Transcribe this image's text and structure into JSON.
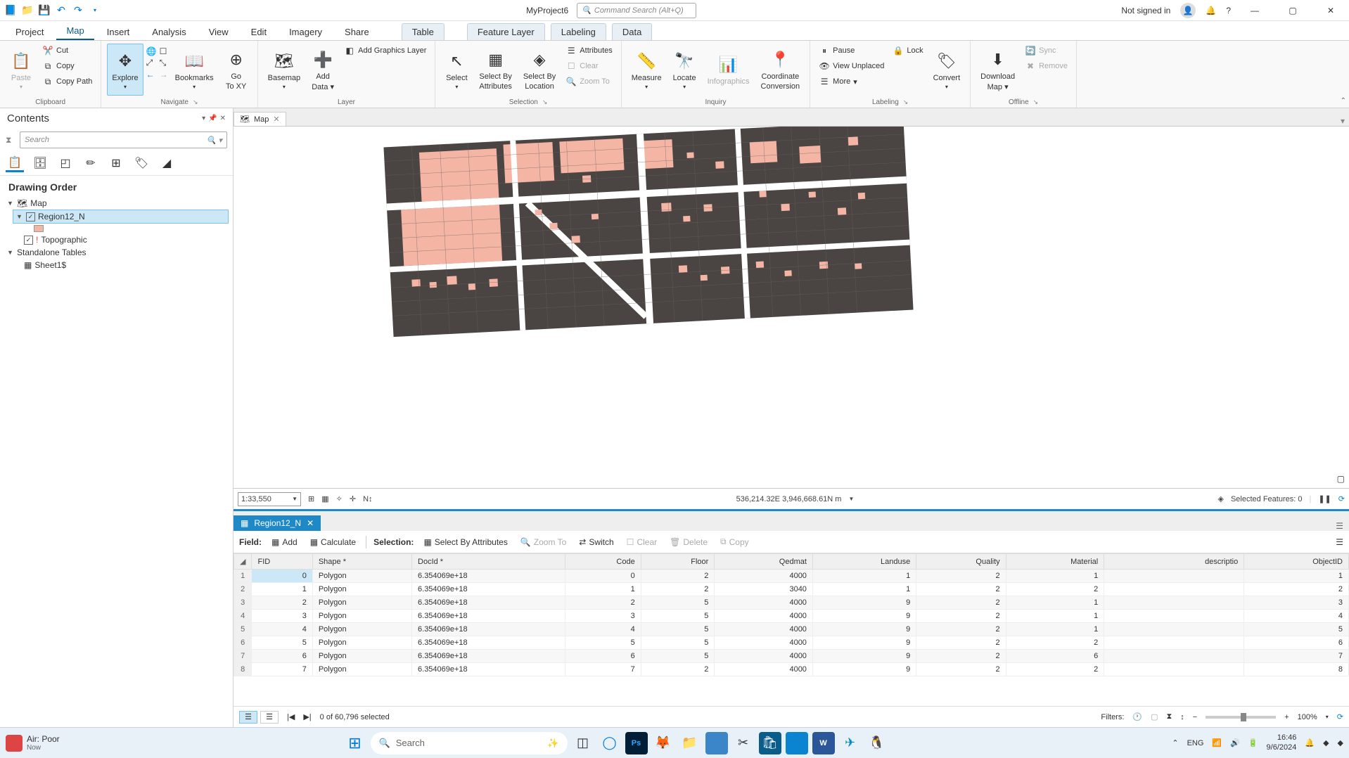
{
  "titlebar": {
    "project_name": "MyProject6",
    "command_search_placeholder": "Command Search (Alt+Q)",
    "signin": "Not signed in"
  },
  "tabs": {
    "project": "Project",
    "map": "Map",
    "insert": "Insert",
    "analysis": "Analysis",
    "view": "View",
    "edit": "Edit",
    "imagery": "Imagery",
    "share": "Share",
    "table": "Table",
    "feature_layer": "Feature Layer",
    "labeling": "Labeling",
    "data": "Data"
  },
  "ribbon": {
    "clipboard": {
      "label": "Clipboard",
      "paste": "Paste",
      "cut": "Cut",
      "copy": "Copy",
      "copy_path": "Copy Path"
    },
    "navigate": {
      "label": "Navigate",
      "explore": "Explore",
      "bookmarks": "Bookmarks",
      "goto_xy_l1": "Go",
      "goto_xy_l2": "To XY"
    },
    "layer": {
      "label": "Layer",
      "basemap": "Basemap",
      "add_data_l1": "Add",
      "add_data_l2": "Data",
      "add_graphics": "Add Graphics Layer"
    },
    "selection": {
      "label": "Selection",
      "select": "Select",
      "by_attr_l1": "Select By",
      "by_attr_l2": "Attributes",
      "by_loc_l1": "Select By",
      "by_loc_l2": "Location",
      "attributes": "Attributes",
      "clear": "Clear",
      "zoom_to": "Zoom To"
    },
    "inquiry": {
      "label": "Inquiry",
      "measure": "Measure",
      "locate": "Locate",
      "infographics": "Infographics",
      "coord_l1": "Coordinate",
      "coord_l2": "Conversion"
    },
    "labeling": {
      "label": "Labeling",
      "pause": "Pause",
      "lock": "Lock",
      "view_unplaced": "View Unplaced",
      "more": "More",
      "convert": "Convert"
    },
    "offline": {
      "label": "Offline",
      "download_l1": "Download",
      "download_l2": "Map",
      "sync": "Sync",
      "remove": "Remove"
    }
  },
  "contents": {
    "title": "Contents",
    "search_placeholder": "Search",
    "drawing_order": "Drawing Order",
    "map_node": "Map",
    "layer_region": "Region12_N",
    "layer_topo": "Topographic",
    "standalone": "Standalone Tables",
    "sheet": "Sheet1$"
  },
  "map_view": {
    "tab": "Map",
    "scale": "1:33,550",
    "coords": "536,214.32E 3,946,668.61N m",
    "selected_features": "Selected Features: 0"
  },
  "attr_table": {
    "tab": "Region12_N",
    "field_label": "Field:",
    "add": "Add",
    "calculate": "Calculate",
    "selection_label": "Selection:",
    "sel_by_attr": "Select By Attributes",
    "zoom_to": "Zoom To",
    "switch": "Switch",
    "clear": "Clear",
    "delete": "Delete",
    "copy": "Copy",
    "columns": [
      "FID",
      "Shape *",
      "DocId *",
      "Code",
      "Floor",
      "Qedmat",
      "Landuse",
      "Quality",
      "Material",
      "descriptio",
      "ObjectID"
    ],
    "rows": [
      {
        "n": 1,
        "fid": 0,
        "shape": "Polygon",
        "docid": "6.354069e+18",
        "code": 0,
        "floor": 2,
        "qedmat": 4000,
        "landuse": 1,
        "quality": 2,
        "material": 1,
        "desc": "",
        "oid": 1
      },
      {
        "n": 2,
        "fid": 1,
        "shape": "Polygon",
        "docid": "6.354069e+18",
        "code": 1,
        "floor": 2,
        "qedmat": 3040,
        "landuse": 1,
        "quality": 2,
        "material": 2,
        "desc": "",
        "oid": 2
      },
      {
        "n": 3,
        "fid": 2,
        "shape": "Polygon",
        "docid": "6.354069e+18",
        "code": 2,
        "floor": 5,
        "qedmat": 4000,
        "landuse": 9,
        "quality": 2,
        "material": 1,
        "desc": "",
        "oid": 3
      },
      {
        "n": 4,
        "fid": 3,
        "shape": "Polygon",
        "docid": "6.354069e+18",
        "code": 3,
        "floor": 5,
        "qedmat": 4000,
        "landuse": 9,
        "quality": 2,
        "material": 1,
        "desc": "",
        "oid": 4
      },
      {
        "n": 5,
        "fid": 4,
        "shape": "Polygon",
        "docid": "6.354069e+18",
        "code": 4,
        "floor": 5,
        "qedmat": 4000,
        "landuse": 9,
        "quality": 2,
        "material": 1,
        "desc": "",
        "oid": 5
      },
      {
        "n": 6,
        "fid": 5,
        "shape": "Polygon",
        "docid": "6.354069e+18",
        "code": 5,
        "floor": 5,
        "qedmat": 4000,
        "landuse": 9,
        "quality": 2,
        "material": 2,
        "desc": "",
        "oid": 6
      },
      {
        "n": 7,
        "fid": 6,
        "shape": "Polygon",
        "docid": "6.354069e+18",
        "code": 6,
        "floor": 5,
        "qedmat": 4000,
        "landuse": 9,
        "quality": 2,
        "material": 6,
        "desc": "",
        "oid": 7
      },
      {
        "n": 8,
        "fid": 7,
        "shape": "Polygon",
        "docid": "6.354069e+18",
        "code": 7,
        "floor": 2,
        "qedmat": 4000,
        "landuse": 9,
        "quality": 2,
        "material": 2,
        "desc": "",
        "oid": 8
      }
    ],
    "record_status": "0 of 60,796 selected",
    "filters": "Filters:",
    "zoom": "100%"
  },
  "taskbar": {
    "weather_l1": "Air: Poor",
    "weather_l2": "Now",
    "search": "Search",
    "lang": "ENG",
    "time": "16:46",
    "date": "9/6/2024"
  }
}
